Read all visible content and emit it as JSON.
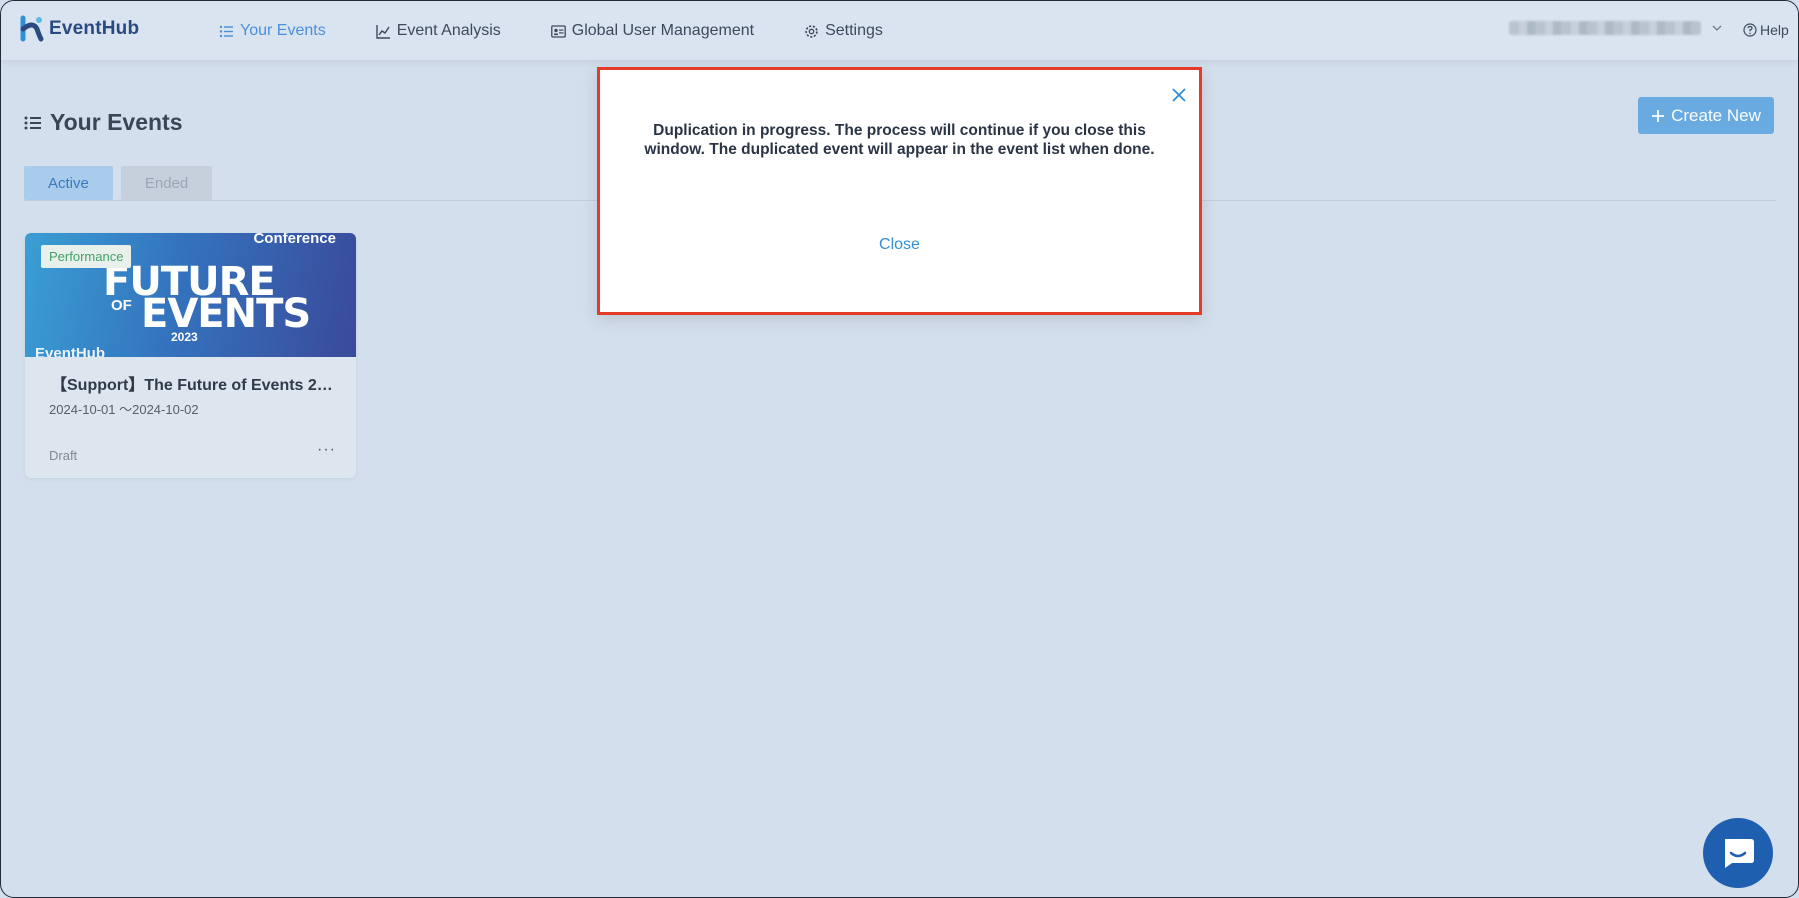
{
  "app": {
    "name": "EventHub",
    "accent_color": "#4a90d9",
    "brand_color": "#2a4a82"
  },
  "nav": {
    "items": [
      {
        "label": "Your Events",
        "icon": "list-icon",
        "active": true
      },
      {
        "label": "Event Analysis",
        "icon": "chart-line-icon",
        "active": false
      },
      {
        "label": "Global User Management",
        "icon": "id-card-icon",
        "active": false
      },
      {
        "label": "Settings",
        "icon": "gear-icon",
        "active": false
      }
    ],
    "help_label": "Help"
  },
  "page": {
    "title": "Your Events",
    "create_button_label": "Create New",
    "tabs": [
      {
        "label": "Active",
        "selected": true
      },
      {
        "label": "Ended",
        "selected": false
      }
    ]
  },
  "events": [
    {
      "badge": "Performance",
      "banner": {
        "line_conference": "Conference",
        "line_future": "FUTURE",
        "line_of": "OF",
        "line_events": "EVENTS",
        "line_year": "2023",
        "line_brand": "EventHub"
      },
      "title": "【Support】The Future of Events 2…",
      "dates": "2024-10-01 〜2024-10-02",
      "status": "Draft",
      "more_label": "···"
    }
  ],
  "modal": {
    "message": "Duplication in progress. The process will continue if you close this window. The duplicated event will appear in the event list when done.",
    "close_label": "Close",
    "border_color": "#e33a2a"
  }
}
